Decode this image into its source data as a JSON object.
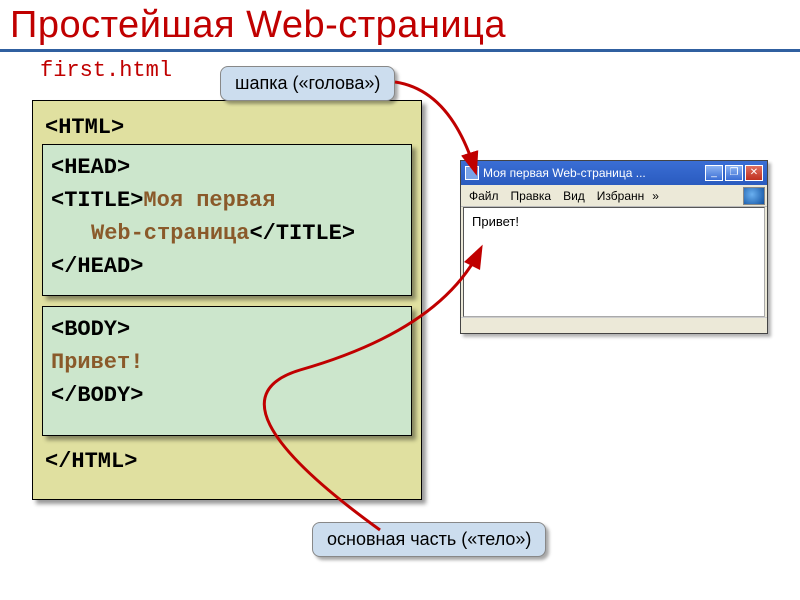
{
  "title": "Простейшая Web-страница",
  "filename": "first.html",
  "callout_head": "шапка («голова»)",
  "callout_body": "основная часть («тело»)",
  "code": {
    "html_open": "<HTML>",
    "html_close": "</HTML>",
    "head_open": "<HEAD>",
    "head_close": "</HEAD>",
    "title_open": "<TITLE>",
    "title_text1": "Моя первая",
    "title_text2": "Web-страница",
    "title_close": "</TITLE>",
    "body_open": "<BODY>",
    "body_text": "Привет!",
    "body_close": "</BODY>"
  },
  "browser": {
    "window_title": "Моя первая Web-страница ...",
    "menu_file": "Файл",
    "menu_edit": "Правка",
    "menu_view": "Вид",
    "menu_fav": "Избранн",
    "chevron": "»",
    "content": "Привет!",
    "min": "_",
    "max": "❐",
    "close": "✕"
  }
}
